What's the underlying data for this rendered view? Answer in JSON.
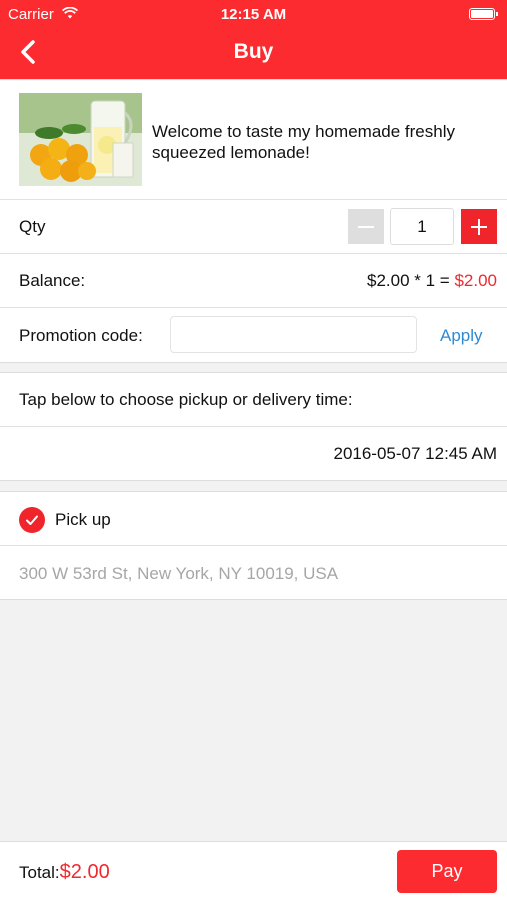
{
  "status_bar": {
    "carrier": "Carrier",
    "time": "12:15 AM"
  },
  "nav": {
    "title": "Buy"
  },
  "product": {
    "description": "Welcome to taste my homemade freshly squeezed lemonade!"
  },
  "quantity": {
    "label": "Qty",
    "value": "1"
  },
  "balance": {
    "label": "Balance:",
    "formula": "$2.00 * 1 = ",
    "total": "$2.00"
  },
  "promotion": {
    "label": "Promotion code:",
    "placeholder": "",
    "apply_label": "Apply"
  },
  "schedule": {
    "prompt": "Tap below to choose pickup or delivery time:",
    "datetime": "2016-05-07 12:45 AM"
  },
  "pickup": {
    "label": "Pick up",
    "selected": true,
    "address": "300 W 53rd St, New York, NY 10019, USA"
  },
  "footer": {
    "total_label": "Total:",
    "total_amount": "$2.00",
    "pay_label": "Pay"
  },
  "colors": {
    "accent": "#fb2b2f",
    "price": "#ee2a2f",
    "link": "#2f8ad6",
    "muted": "#a6a6a6"
  }
}
